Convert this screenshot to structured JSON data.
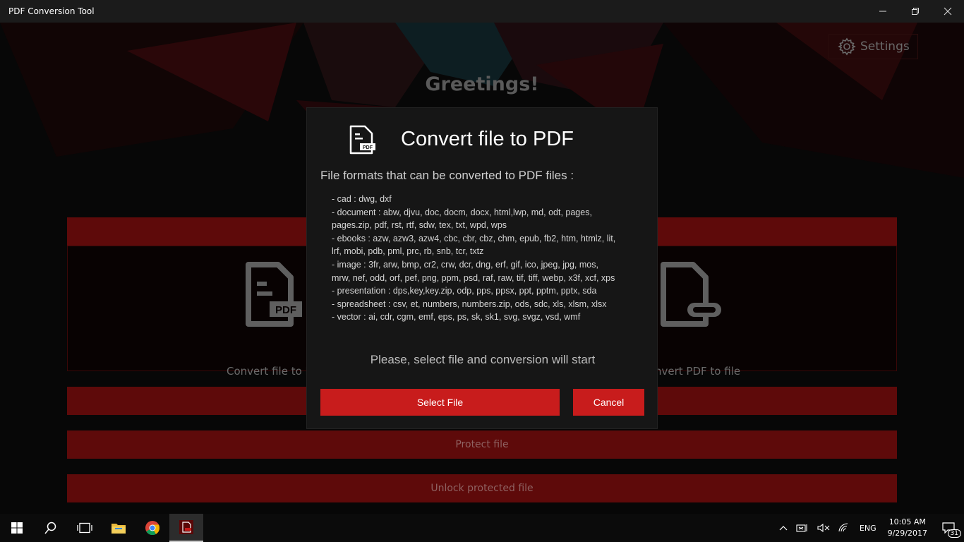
{
  "window": {
    "title": "PDF Conversion Tool"
  },
  "header": {
    "settings_label": "Settings",
    "greeting": "Greetings!"
  },
  "main": {
    "tiles": [
      {
        "label": "Convert file to P"
      },
      {
        "label": "nvert PDF to file"
      }
    ],
    "pdf_badge": "PDF",
    "buttons": {
      "protect": "Protect file",
      "unlock": "Unlock protected file"
    }
  },
  "dialog": {
    "title": "Convert file to PDF",
    "subtitle": "File formats that can be converted to PDF files :",
    "formats": [
      "- cad : dwg, dxf",
      "- document : abw, djvu, doc, docm, docx, html,lwp, md, odt, pages,",
      "pages.zip, pdf, rst, rtf, sdw, tex, txt, wpd, wps",
      "- ebooks : azw, azw3, azw4, cbc, cbr, cbz, chm, epub, fb2, htm, htmlz, lit,",
      "lrf, mobi, pdb, pml, prc, rb, snb, tcr, txtz",
      "- image : 3fr, arw, bmp, cr2, crw, dcr, dng, erf, gif, ico, jpeg, jpg, mos,",
      "mrw, nef, odd, orf, pef, png, ppm, psd, raf, raw, tif, tiff, webp, x3f, xcf, xps",
      "- presentation : dps,key,key.zip, odp, pps, ppsx, ppt, pptm, pptx, sda",
      "- spreadsheet : csv, et, numbers, numbers.zip, ods, sdc, xls, xlsm, xlsx",
      "- vector : ai, cdr, cgm, emf, eps, ps, sk, sk1, svg, svgz, vsd, wmf"
    ],
    "icon_badge": "PDF",
    "hint": "Please, select file and conversion will start",
    "select_label": "Select File",
    "cancel_label": "Cancel"
  },
  "taskbar": {
    "language": "ENG",
    "time": "10:05 AM",
    "date": "9/29/2017",
    "notification_count": "31"
  },
  "colors": {
    "accent": "#c81c1c",
    "dark_red": "#5e0a0a",
    "dialog_bg": "#161616"
  }
}
